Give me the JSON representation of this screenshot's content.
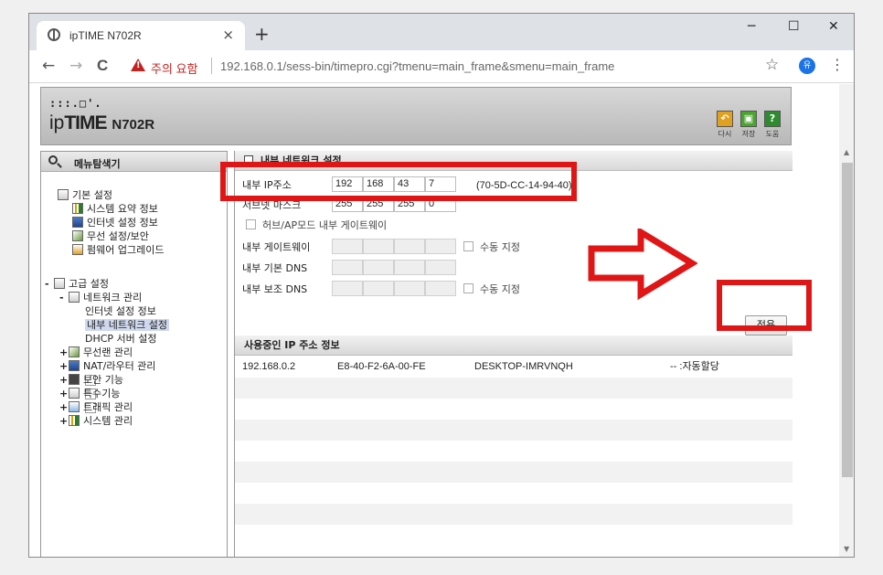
{
  "browser": {
    "tab_title": "ipTIME N702R",
    "tab_close": "×",
    "new_tab": "+",
    "min": "─",
    "max": "☐",
    "close": "✕",
    "nav_back": "←",
    "nav_forward": "→",
    "nav_reload": "C",
    "insecure_label": "주의 요함",
    "url": "192.168.0.1/sess-bin/timepro.cgi?tmenu=main_frame&smenu=main_frame",
    "bookmark": "☆",
    "menu": "⋮"
  },
  "router": {
    "logo_dots": ":::.□'.",
    "brand_ip": "ip",
    "brand_time": "TIME",
    "model": "N702R",
    "actions": [
      {
        "label": "다시",
        "color": "#e0a020",
        "glyph": "↶"
      },
      {
        "label": "저장",
        "color": "#4aa52e",
        "glyph": "▣"
      },
      {
        "label": "도움",
        "color": "#2e8b2e",
        "glyph": "?"
      }
    ]
  },
  "nav": {
    "title": "메뉴탐색기",
    "basic_group": "기본 설정",
    "basic_items": [
      "시스템 요약 정보",
      "인터넷 설정 정보",
      "무선 설정/보안",
      "펌웨어 업그레이드"
    ],
    "advanced_group": "고급 설정",
    "network_group": "네트워크 관리",
    "network_items": [
      "인터넷 설정 정보",
      "내부 네트워크 설정",
      "DHCP 서버 설정"
    ],
    "other_groups": [
      "무선랜 관리",
      "NAT/라우터 관리",
      "보안 기능",
      "특수기능",
      "트래픽 관리",
      "시스템 관리"
    ],
    "expand_plus": "+",
    "expand_minus": "-"
  },
  "form": {
    "section_title": "내부 네트워크 설정",
    "ip_label": "내부 IP주소",
    "ip": [
      "192",
      "168",
      "43",
      "7"
    ],
    "mac": "(70-5D-CC-14-94-40)",
    "mask_label": "서브넷 마스크",
    "mask": [
      "255",
      "255",
      "255",
      "0"
    ],
    "hub_ap_label": "허브/AP모드 내부 게이트웨이",
    "gateway_label": "내부 게이트웨이",
    "dns1_label": "내부 기본 DNS",
    "dns2_label": "내부 보조 DNS",
    "manual_label": "수동 지정",
    "apply_label": "적용"
  },
  "ip_table": {
    "title": "사용중인 IP 주소 정보",
    "rows": [
      {
        "ip": "192.168.0.2",
        "mac": "E8-40-F2-6A-00-FE",
        "name": "DESKTOP-IMRVNQH",
        "type": "-- :자동할당"
      }
    ]
  },
  "colors": {
    "annotation_red": "#e01616",
    "warning_red": "#c5221f"
  }
}
